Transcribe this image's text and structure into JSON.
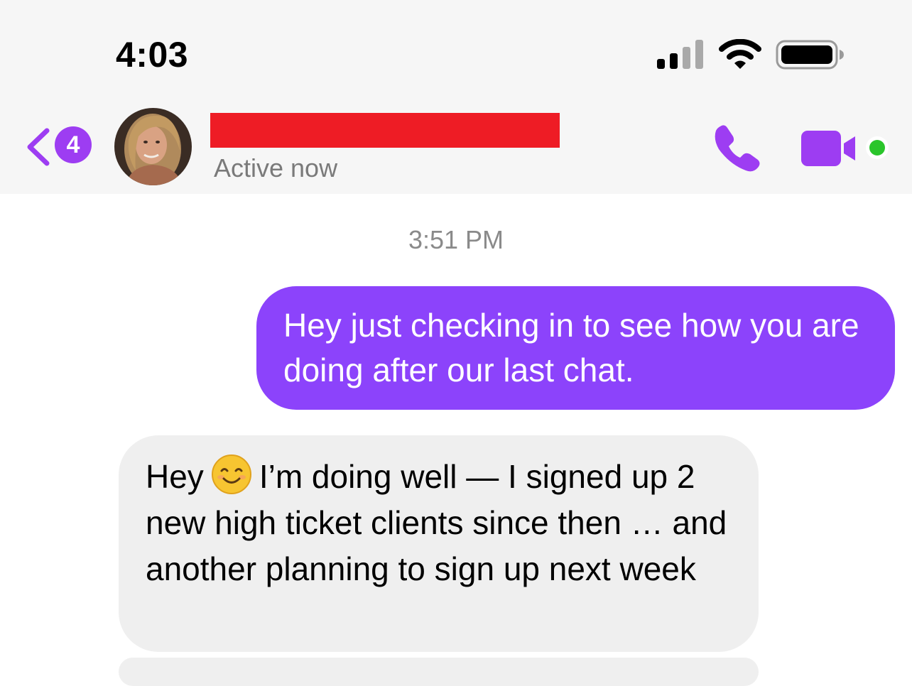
{
  "status_bar": {
    "time": "4:03",
    "signal_icon": "cellular-signal-icon",
    "wifi_icon": "wifi-icon",
    "battery_icon": "battery-icon"
  },
  "header": {
    "back_icon": "chevron-left-icon",
    "unread_count": "4",
    "contact_name_redacted": true,
    "active_status": "Active now",
    "call_icon": "phone-icon",
    "video_icon": "video-camera-icon"
  },
  "conversation": {
    "timestamp": "3:51 PM",
    "messages": [
      {
        "direction": "sent",
        "text": "Hey just checking in to see how you are doing after our last chat."
      },
      {
        "direction": "received",
        "text_before_emoji": "Hey",
        "emoji": "smiling-face-icon",
        "text_after_emoji": "I’m doing well — I signed up 2 new high ticket clients since then … and another planning to sign up next week"
      }
    ]
  },
  "colors": {
    "accent": "#9d3df2",
    "sent_bubble": "#8c43fb",
    "received_bubble": "#efefef",
    "redaction": "#ee1c25",
    "online_dot": "#2ac52b"
  }
}
